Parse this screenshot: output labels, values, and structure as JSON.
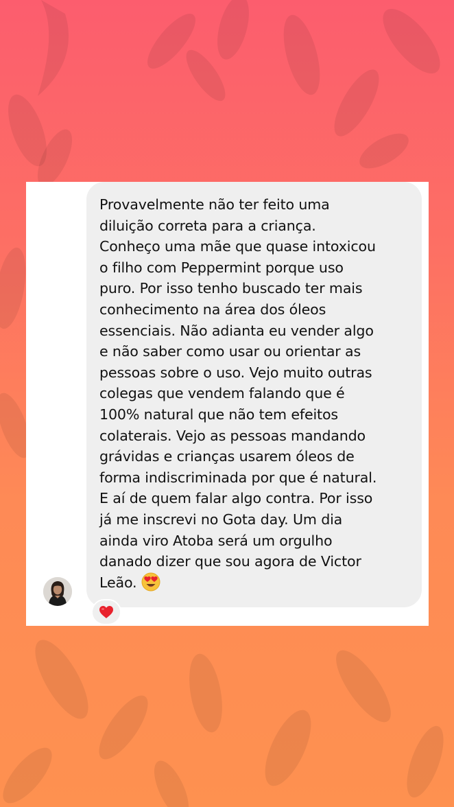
{
  "message": {
    "text": "Provavelmente não ter feito uma\ndiluição correta para a criança.\nConheço uma mãe que quase intoxicou\no filho com Peppermint porque uso\npuro. Por isso tenho buscado ter mais\nconhecimento na área dos óleos\nessenciais.  Não adianta eu vender algo\ne não saber como usar ou orientar as\npessoas sobre o uso. Vejo muito outras\ncolegas que vendem falando que é\n100% natural que não tem efeitos\ncolaterais.  Vejo as pessoas mandando\ngrávidas e crianças usarem óleos de\nforma indiscriminada por que é natural.\nE aí de quem falar algo contra. Por isso\njá me inscrevi no Gota day. Um dia\nainda viro Atoba  será um orgulho\ndanado dizer que sou agora de Victor\nLeão.  ",
    "trailing_emoji": "heart-eyes-emoji"
  },
  "sender": {
    "avatar_icon": "avatar-photo"
  },
  "reaction": {
    "icon": "red-heart-icon"
  },
  "colors": {
    "background_top": "#fc5d6e",
    "background_bottom": "#fe9150",
    "bubble": "#efefef",
    "card": "#ffffff",
    "text": "#111111",
    "heart": "#e8222d"
  }
}
